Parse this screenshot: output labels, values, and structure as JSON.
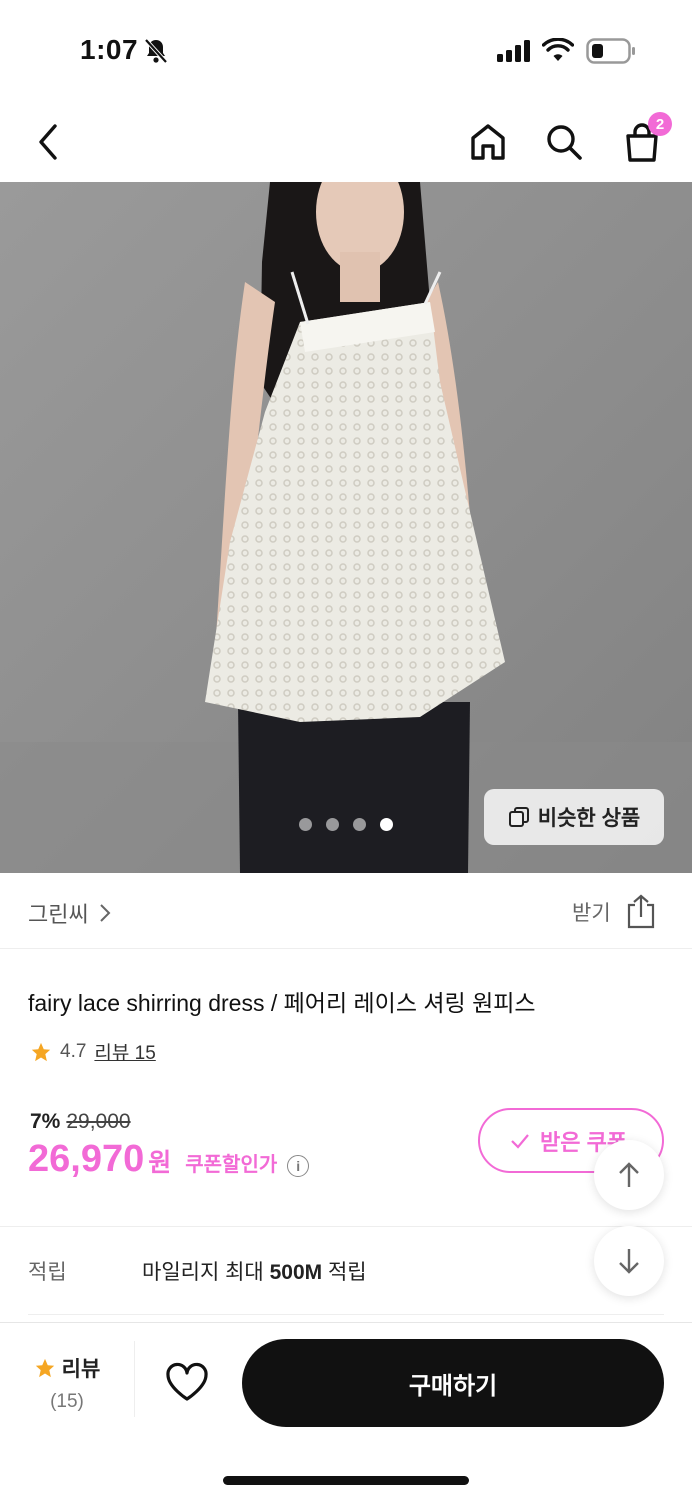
{
  "status": {
    "time": "1:07"
  },
  "nav": {
    "cart_badge": "2"
  },
  "hero": {
    "similar_label": "비슷한 상품",
    "page_count": 4,
    "active_page": 4
  },
  "brand": {
    "name": "그린씨",
    "action": "받기"
  },
  "product": {
    "title": "fairy lace shirring dress / 페어리 레이스 셔링 원피스",
    "rating": "4.7",
    "review_link": "리뷰 15",
    "discount_rate": "7%",
    "original_price": "29,000",
    "price": "26,970",
    "currency": "원",
    "coupon_price_label": "쿠폰할인가",
    "coupon_button": "받은 쿠폰"
  },
  "mileage": {
    "label": "적립",
    "prefix": "마일리지 최대 ",
    "amount": "500M",
    "suffix": " 적립"
  },
  "bottom": {
    "review_label": "리뷰",
    "review_count": "(15)",
    "buy_label": "구매하기"
  },
  "colors": {
    "accent": "#f26ad6",
    "star": "#f5a623",
    "dark": "#111111"
  }
}
